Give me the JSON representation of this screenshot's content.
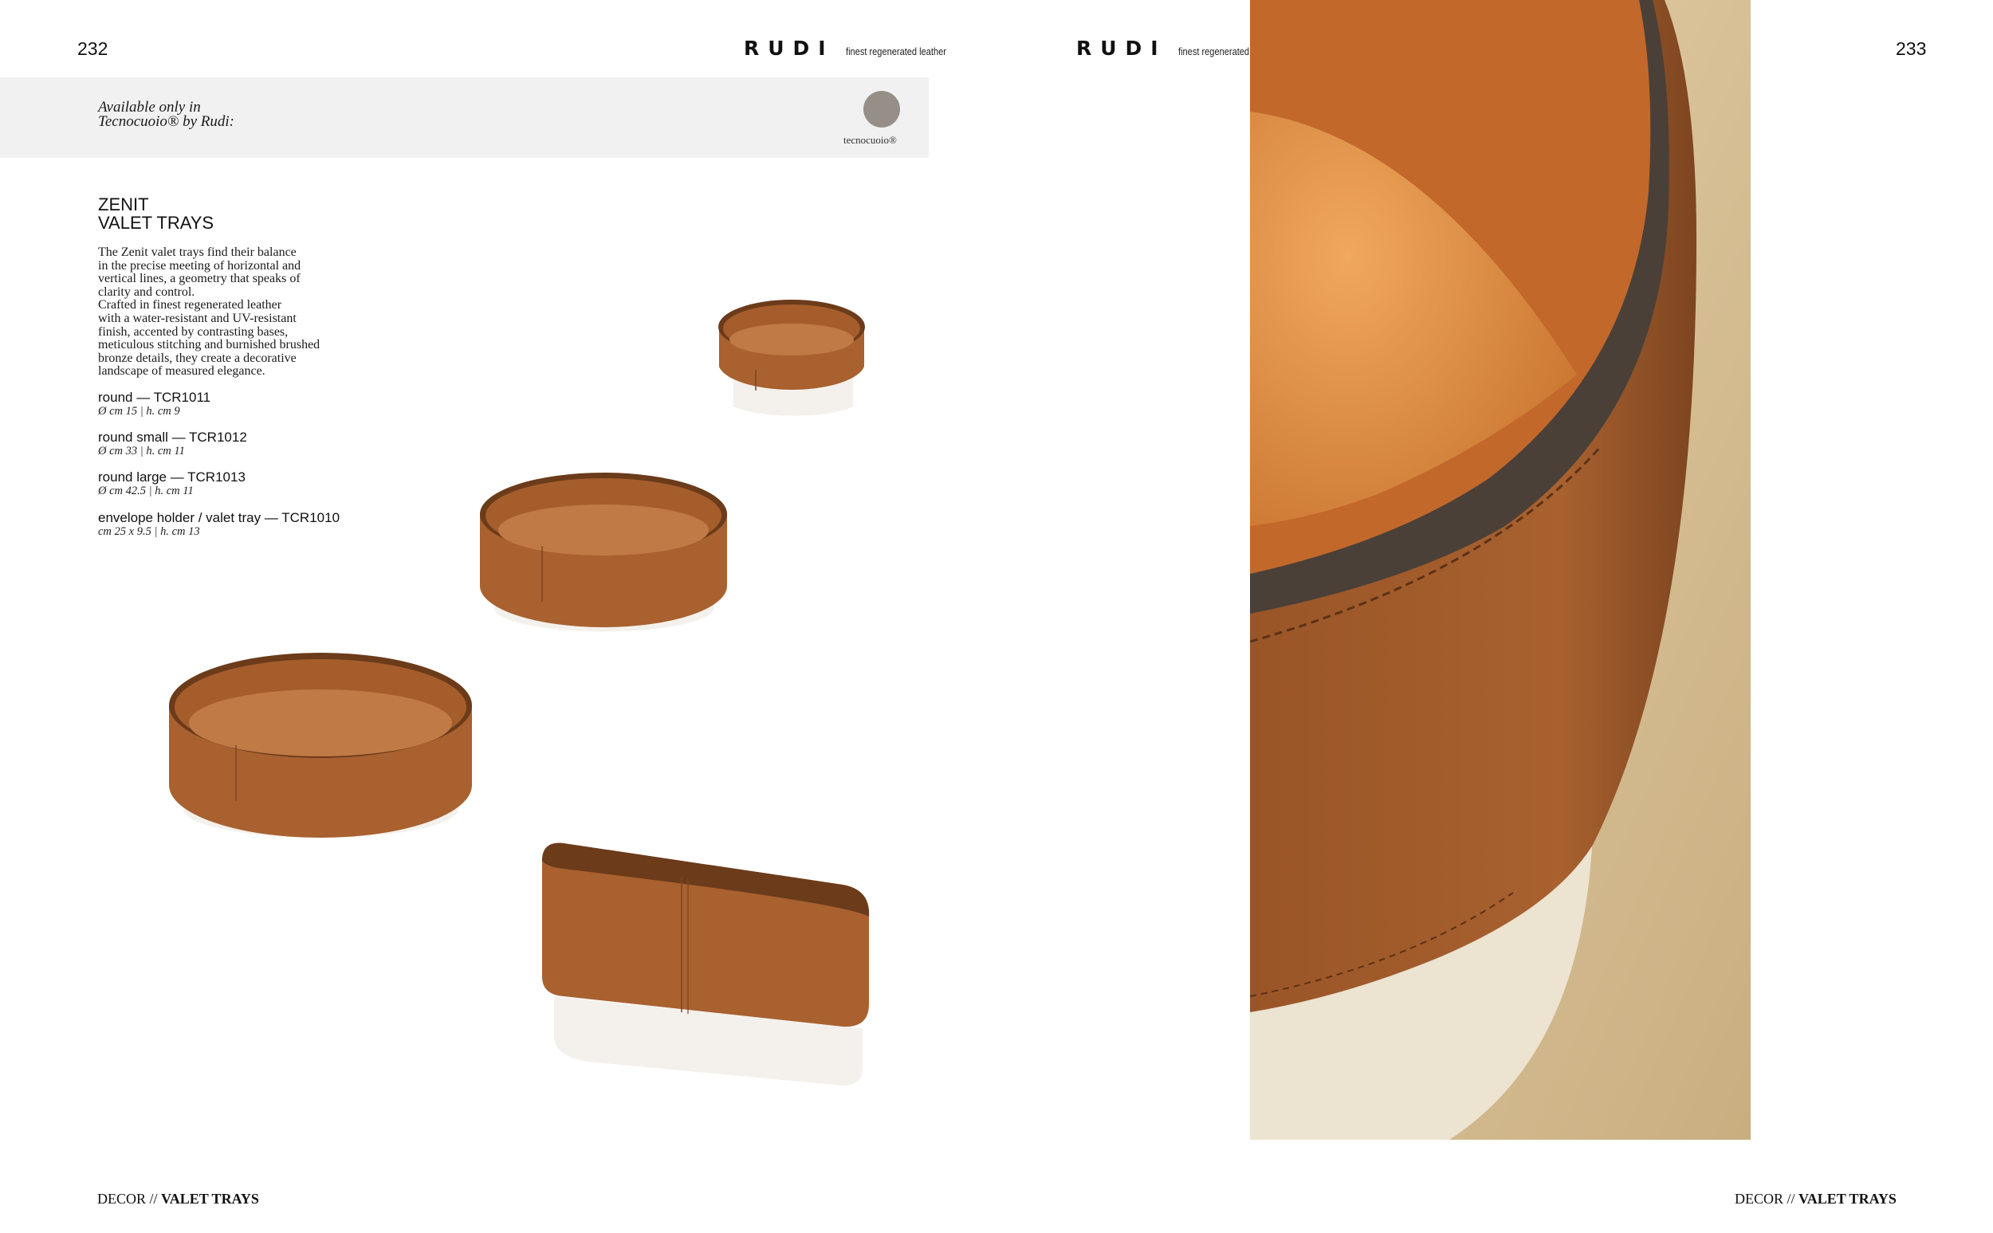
{
  "left_page": {
    "page_number": "232",
    "brand": {
      "logo": "RUDI",
      "tagline": "finest regenerated leather"
    },
    "availability": {
      "line1": "Available only in",
      "line2": "Tecnocuoio® by Rudi:",
      "swatch_label": "tecnocuoio®",
      "swatch_color": "#968f87"
    },
    "title_line1": "ZENIT",
    "title_line2": "VALET TRAYS",
    "description": [
      "The Zenit valet trays find their balance",
      "in the precise meeting of horizontal and",
      "vertical lines, a geometry that speaks of",
      "clarity and control.",
      "Crafted in finest regenerated leather",
      "with a water-resistant and UV-resistant",
      "finish, accented by contrasting bases,",
      "meticulous stitching and burnished brushed",
      "bronze details, they create a decorative",
      "landscape of measured elegance."
    ],
    "products": [
      {
        "name": "round — TCR1011",
        "dims": "Ø cm 15 | h. cm 9"
      },
      {
        "name": "round small — TCR1012",
        "dims": "Ø cm 33 | h. cm 11"
      },
      {
        "name": "round large — TCR1013",
        "dims": "Ø cm 42.5 | h. cm 11"
      },
      {
        "name": "envelope holder / valet tray — TCR1010",
        "dims": "cm 25 x 9.5 | h. cm 13"
      }
    ],
    "footer": {
      "section": "DECOR //",
      "subsection": "VALET TRAYS"
    }
  },
  "right_page": {
    "page_number": "233",
    "brand": {
      "logo": "RUDI",
      "tagline": "finest regenerated leather"
    },
    "footer": {
      "section": "DECOR //",
      "subsection": "VALET TRAYS"
    }
  },
  "colors": {
    "leather": "#a8612f",
    "leather_dark": "#7d4520",
    "base": "#eeeae4",
    "suede": "#d9c29a"
  }
}
